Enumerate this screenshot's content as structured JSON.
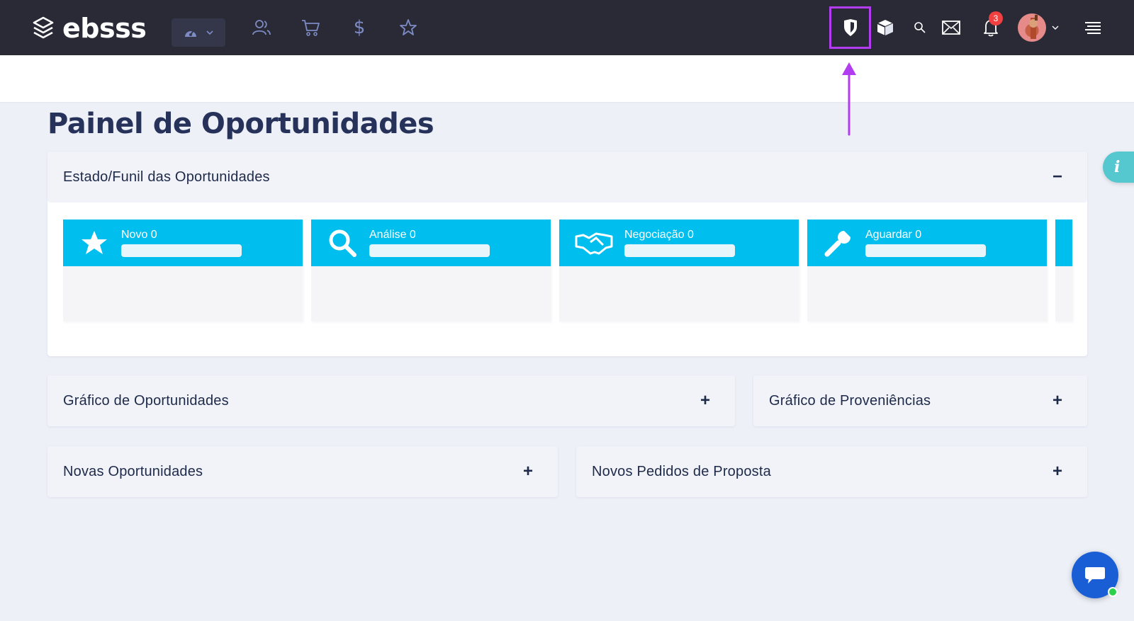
{
  "app": {
    "logo_text": "ebsss"
  },
  "nav": {
    "icons": [
      "dashboard-icon",
      "users-icon",
      "cart-icon",
      "dollar-icon",
      "star-icon"
    ],
    "right_icons": [
      "shield-icon",
      "cube-icon",
      "search-icon",
      "mail-icon",
      "bell-icon",
      "avatar",
      "menu-icon"
    ],
    "notifications_count": "3"
  },
  "page": {
    "title": "Painel de Oportunidades"
  },
  "funnel": {
    "title": "Estado/Funil das Oportunidades",
    "toggle": "−",
    "stages": [
      {
        "label": "Novo 0",
        "icon": "star-icon"
      },
      {
        "label": "Análise 0",
        "icon": "search-icon"
      },
      {
        "label": "Negociação 0",
        "icon": "handshake-icon"
      },
      {
        "label": "Aguardar 0",
        "icon": "wrench-icon"
      }
    ]
  },
  "panels": {
    "grafico_oportunidades": {
      "title": "Gráfico de Oportunidades",
      "toggle": "+"
    },
    "grafico_proveniencias": {
      "title": "Gráfico de Proveniências",
      "toggle": "+"
    },
    "novas_oportunidades": {
      "title": "Novas Oportunidades",
      "toggle": "+"
    },
    "novos_pedidos": {
      "title": "Novos Pedidos de Proposta",
      "toggle": "+"
    }
  },
  "colors": {
    "nav_bg": "#292a36",
    "stage_accent": "#00bfef",
    "highlight": "#b23cf0",
    "chat": "#1a5ed6"
  }
}
